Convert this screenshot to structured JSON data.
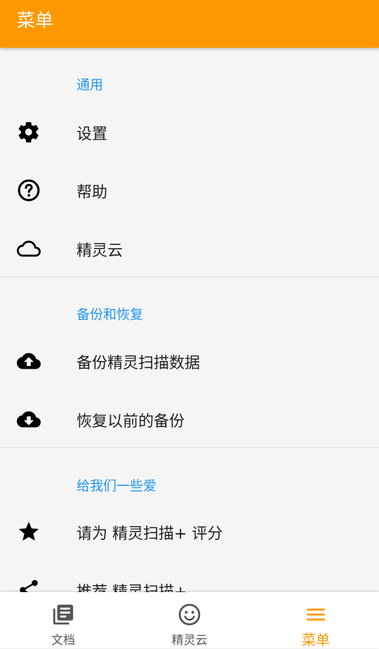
{
  "appbar": {
    "title": "菜单"
  },
  "sections": {
    "general": {
      "header": "通用",
      "items": [
        {
          "label": "设置",
          "icon": "gear-icon"
        },
        {
          "label": "帮助",
          "icon": "help-circle-icon"
        },
        {
          "label": "精灵云",
          "icon": "cloud-outline-icon"
        }
      ]
    },
    "backup": {
      "header": "备份和恢复",
      "items": [
        {
          "label": "备份精灵扫描数据",
          "icon": "cloud-upload-icon"
        },
        {
          "label": "恢复以前的备份",
          "icon": "cloud-download-icon"
        }
      ]
    },
    "love": {
      "header": "给我们一些爱",
      "items": [
        {
          "label": "请为 精灵扫描+ 评分",
          "icon": "star-icon"
        },
        {
          "label": "推荐 精灵扫描+",
          "icon": "share-icon"
        }
      ]
    }
  },
  "bottom_nav": {
    "tabs": [
      {
        "label": "文档",
        "icon": "documents-icon"
      },
      {
        "label": "精灵云",
        "icon": "smiley-icon"
      },
      {
        "label": "菜单",
        "icon": "menu-icon",
        "active": true
      }
    ],
    "active_color": "#ff9800"
  },
  "colors": {
    "accent": "#ff9800",
    "section_header": "#2196f3"
  }
}
